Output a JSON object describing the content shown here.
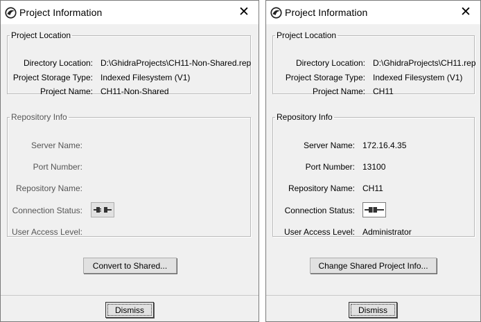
{
  "dialogs": [
    {
      "title": "Project Information",
      "project_location": {
        "legend": "Project Location",
        "rows": [
          {
            "label": "Directory Location:",
            "value": "D:\\GhidraProjects\\CH11-Non-Shared.rep"
          },
          {
            "label": "Project Storage Type:",
            "value": "Indexed Filesystem (V1)"
          },
          {
            "label": "Project Name:",
            "value": "CH11-Non-Shared"
          }
        ]
      },
      "repository_info": {
        "legend": "Repository Info",
        "server_name_label": "Server Name:",
        "server_name": "",
        "port_number_label": "Port Number:",
        "port_number": "",
        "repository_name_label": "Repository Name:",
        "repository_name": "",
        "connection_status_label": "Connection Status:",
        "connection_icon": "disconnected-plug-icon",
        "user_access_level_label": "User Access Level:",
        "user_access_level": ""
      },
      "action_button": "Convert to Shared...",
      "dismiss_button": "Dismiss"
    },
    {
      "title": "Project Information",
      "project_location": {
        "legend": "Project Location",
        "rows": [
          {
            "label": "Directory Location:",
            "value": "D:\\GhidraProjects\\CH11.rep"
          },
          {
            "label": "Project Storage Type:",
            "value": "Indexed Filesystem (V1)"
          },
          {
            "label": "Project Name:",
            "value": "CH11"
          }
        ]
      },
      "repository_info": {
        "legend": "Repository Info",
        "server_name_label": "Server Name:",
        "server_name": "172.16.4.35",
        "port_number_label": "Port Number:",
        "port_number": "13100",
        "repository_name_label": "Repository Name:",
        "repository_name": "CH11",
        "connection_status_label": "Connection Status:",
        "connection_icon": "connected-plug-icon",
        "user_access_level_label": "User Access Level:",
        "user_access_level": "Administrator"
      },
      "action_button": "Change Shared Project Info...",
      "dismiss_button": "Dismiss"
    }
  ],
  "close_glyph": "✕"
}
